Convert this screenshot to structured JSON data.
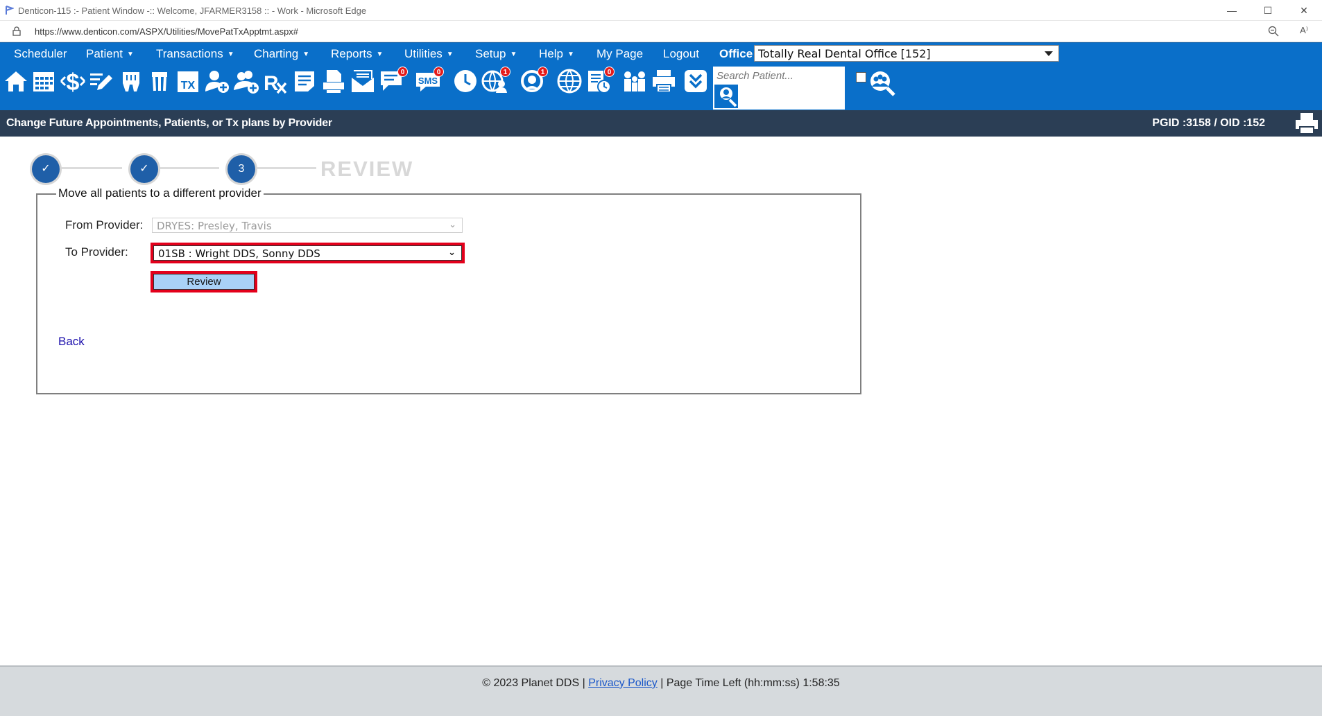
{
  "window": {
    "title": "Denticon-115 :- Patient Window -:: Welcome, JFARMER3158 :: - Work - Microsoft Edge",
    "url": "https://www.denticon.com/ASPX/Utilities/MovePatTxApptmt.aspx#",
    "controls": {
      "minimize": "—",
      "maximize": "☐",
      "close": "✕"
    },
    "read_aloud": "A⁾"
  },
  "menu": {
    "items": [
      {
        "label": "Scheduler",
        "caret": false
      },
      {
        "label": "Patient",
        "caret": true
      },
      {
        "label": "Transactions",
        "caret": true
      },
      {
        "label": "Charting",
        "caret": true
      },
      {
        "label": "Reports",
        "caret": true
      },
      {
        "label": "Utilities",
        "caret": true
      },
      {
        "label": "Setup",
        "caret": true
      },
      {
        "label": "Help",
        "caret": true
      },
      {
        "label": "My Page",
        "caret": false
      },
      {
        "label": "Logout",
        "caret": false
      }
    ],
    "caret_glyph": "▼",
    "office_label": "Office",
    "office_value": "Totally Real Dental Office [152]"
  },
  "toolbar": {
    "icons": [
      "home-icon",
      "calendar-icon",
      "dollar-icon",
      "edit-icon",
      "tooth-icon",
      "tooth-roots-icon",
      "tx-icon",
      "add-user-icon",
      "add-group-icon",
      "rx-icon",
      "notes-icon",
      "print-doc-icon",
      "email-icon",
      "chat-icon",
      "sms-icon",
      "clock-icon",
      "globe-user-icon",
      "support-icon",
      "globe-icon",
      "forms-icon",
      "family-icon",
      "printer-icon",
      "download-icon"
    ],
    "badges": {
      "chat": "0",
      "sms": "0",
      "globe_user": "1",
      "support": "1",
      "forms": "0"
    },
    "search_placeholder": "Search Patient..."
  },
  "header": {
    "title": "Change Future Appointments, Patients, or Tx plans by Provider",
    "ids": "PGID :3158  /  OID :152"
  },
  "stepper": {
    "steps": [
      "✓",
      "✓",
      "3"
    ],
    "label": "REVIEW"
  },
  "form": {
    "legend": "Move all patients to a different provider",
    "from_label": "From Provider:",
    "from_value": "DRYES: Presley, Travis",
    "to_label": "To Provider:",
    "to_value": "01SB : Wright DDS, Sonny DDS",
    "review_button": "Review",
    "back_link": "Back",
    "chevron": "⌄"
  },
  "footer": {
    "copyright": "© 2023 Planet DDS |",
    "privacy": "Privacy Policy",
    "time_left": "|  Page Time Left (hh:mm:ss) 1:58:35"
  },
  "colors": {
    "menu_blue": "#0a6fc9",
    "header_navy": "#2b3e55",
    "step_blue": "#1f5fa8",
    "highlight_red": "#e3001b",
    "button_blue": "#a9d1f7"
  }
}
